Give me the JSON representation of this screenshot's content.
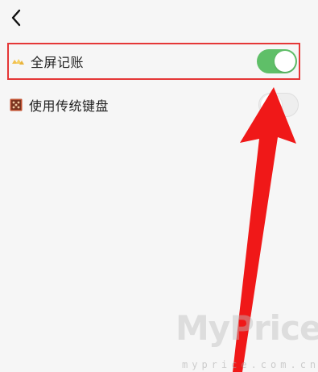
{
  "header": {
    "back_icon": "chevron-left-icon"
  },
  "settings": {
    "items": [
      {
        "label": "全屏记账",
        "icon": "gold-bars-icon",
        "toggle_on": true,
        "highlighted": true
      },
      {
        "label": "使用传统键盘",
        "icon": "abacus-icon",
        "toggle_on": false,
        "highlighted": false
      }
    ]
  },
  "colors": {
    "toggle_on": "#5fbf68",
    "toggle_off": "#eeeeee",
    "highlight_border": "#e53737",
    "annotation_arrow": "#f01818",
    "background": "#f6f6f6"
  },
  "watermark": {
    "main": "MyPrice",
    "sub": "myprice.com.cn"
  }
}
